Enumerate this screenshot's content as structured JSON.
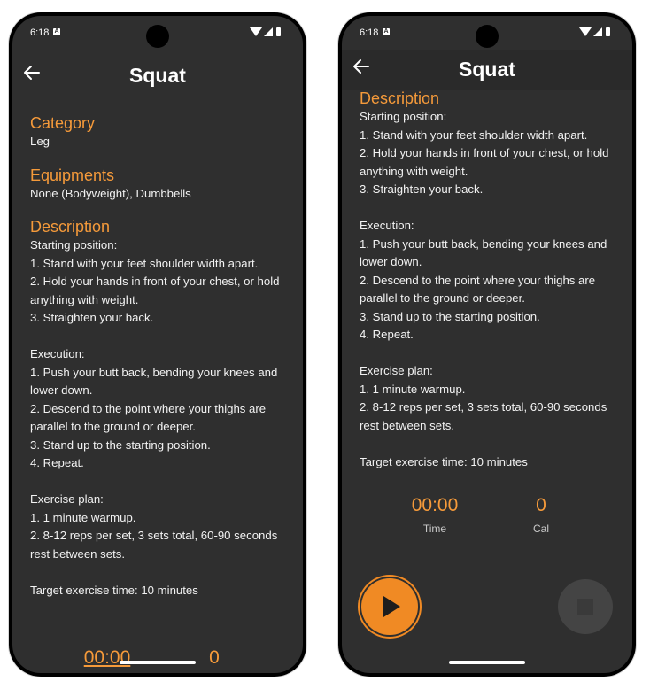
{
  "status": {
    "time": "6:18",
    "notif": "A"
  },
  "appbar": {
    "title": "Squat"
  },
  "sections": {
    "category": {
      "title": "Category",
      "text": "Leg"
    },
    "equipments": {
      "title": "Equipments",
      "text": "None (Bodyweight), Dumbbells"
    },
    "description": {
      "title": "Description",
      "lines": [
        "Starting position:",
        "1. Stand with your feet shoulder width apart.",
        "2. Hold your hands in front of your chest, or hold anything with weight.",
        "3. Straighten your back.",
        "",
        "Execution:",
        "1. Push your butt back, bending your knees and lower down.",
        "2. Descend to the point where your thighs are parallel to the ground or deeper.",
        "3. Stand up to the starting position.",
        "4. Repeat.",
        "",
        "Exercise plan:",
        "1. 1 minute warmup.",
        "2. 8-12 reps per set, 3 sets total, 60-90 seconds rest between sets.",
        "",
        "Target exercise time: 10 minutes"
      ]
    }
  },
  "timer": {
    "time_value": "00:00",
    "time_label": "Time",
    "cal_value": "0",
    "cal_label": "Cal"
  },
  "colors": {
    "accent": "#f59a3a",
    "background": "#2f2f2f",
    "text": "#f2f2f2"
  },
  "icons": {
    "back": "arrow-left-icon",
    "play": "play-icon",
    "stop": "stop-icon"
  }
}
